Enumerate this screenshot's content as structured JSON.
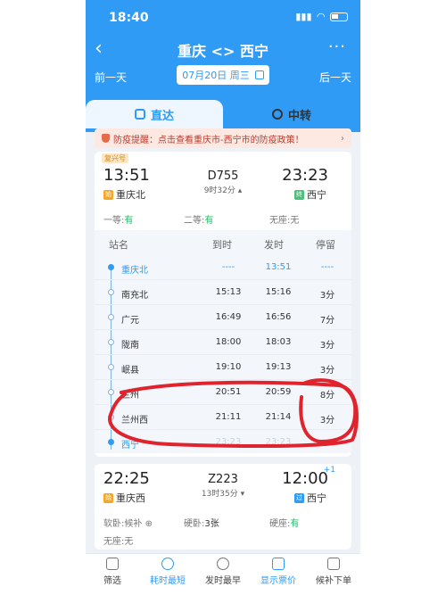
{
  "status": {
    "time": "18:40",
    "battery": "battery-icon"
  },
  "nav": {
    "title": "重庆 <> 西宁",
    "prev": "前一天",
    "next": "后一天",
    "date": "07月20日 周三"
  },
  "tabs": [
    {
      "label": "直达"
    },
    {
      "label": "中转"
    }
  ],
  "notice": {
    "text": "防疫提醒：点击查看重庆市-西宁市的防疫政策！"
  },
  "train1": {
    "badge": "复兴号",
    "dep_time": "13:51",
    "dep_station": "重庆北",
    "dep_tag": "始",
    "number": "D755",
    "duration": "9时32分",
    "arr_time": "23:23",
    "arr_station": "西宁",
    "arr_tag": "终",
    "seats": [
      {
        "label": "一等:",
        "value": "有"
      },
      {
        "label": "二等:",
        "value": "有"
      },
      {
        "label": "无座:",
        "value": "无"
      }
    ]
  },
  "stops_header": {
    "name": "站名",
    "arr": "到时",
    "dep": "发时",
    "stay": "停留"
  },
  "stops": [
    {
      "name": "重庆北",
      "arr": "----",
      "dep": "13:51",
      "stay": "----"
    },
    {
      "name": "南充北",
      "arr": "15:13",
      "dep": "15:16",
      "stay": "3分"
    },
    {
      "name": "广元",
      "arr": "16:49",
      "dep": "16:56",
      "stay": "7分"
    },
    {
      "name": "陇南",
      "arr": "18:00",
      "dep": "18:03",
      "stay": "3分"
    },
    {
      "name": "岷县",
      "arr": "19:10",
      "dep": "19:13",
      "stay": "3分"
    },
    {
      "name": "兰州",
      "arr": "20:51",
      "dep": "20:59",
      "stay": "8分"
    },
    {
      "name": "兰州西",
      "arr": "21:11",
      "dep": "21:14",
      "stay": "3分"
    },
    {
      "name": "西宁",
      "arr": "23:23",
      "dep": "23:23",
      "stay": ""
    }
  ],
  "train2": {
    "dep_time": "22:25",
    "dep_station": "重庆西",
    "dep_tag": "始",
    "number": "Z223",
    "duration": "13时35分",
    "arr_time": "12:00",
    "arr_plus": "+1",
    "arr_station": "西宁",
    "arr_tag": "过",
    "seats": [
      {
        "label": "软卧:",
        "value": "候补"
      },
      {
        "label": "硬卧:",
        "value": "3张"
      },
      {
        "label": "硬座:",
        "value": "有"
      },
      {
        "label": "无座:",
        "value": "无"
      }
    ]
  },
  "bottom": [
    {
      "label": "筛选"
    },
    {
      "label": "耗时最短"
    },
    {
      "label": "发时最早"
    },
    {
      "label": "显示票价"
    },
    {
      "label": "候补下单"
    }
  ],
  "colors": {
    "header": "#2f9bf5",
    "accent": "#2f9bf5",
    "available": "#2bb56b",
    "annotation": "#e0242e"
  }
}
